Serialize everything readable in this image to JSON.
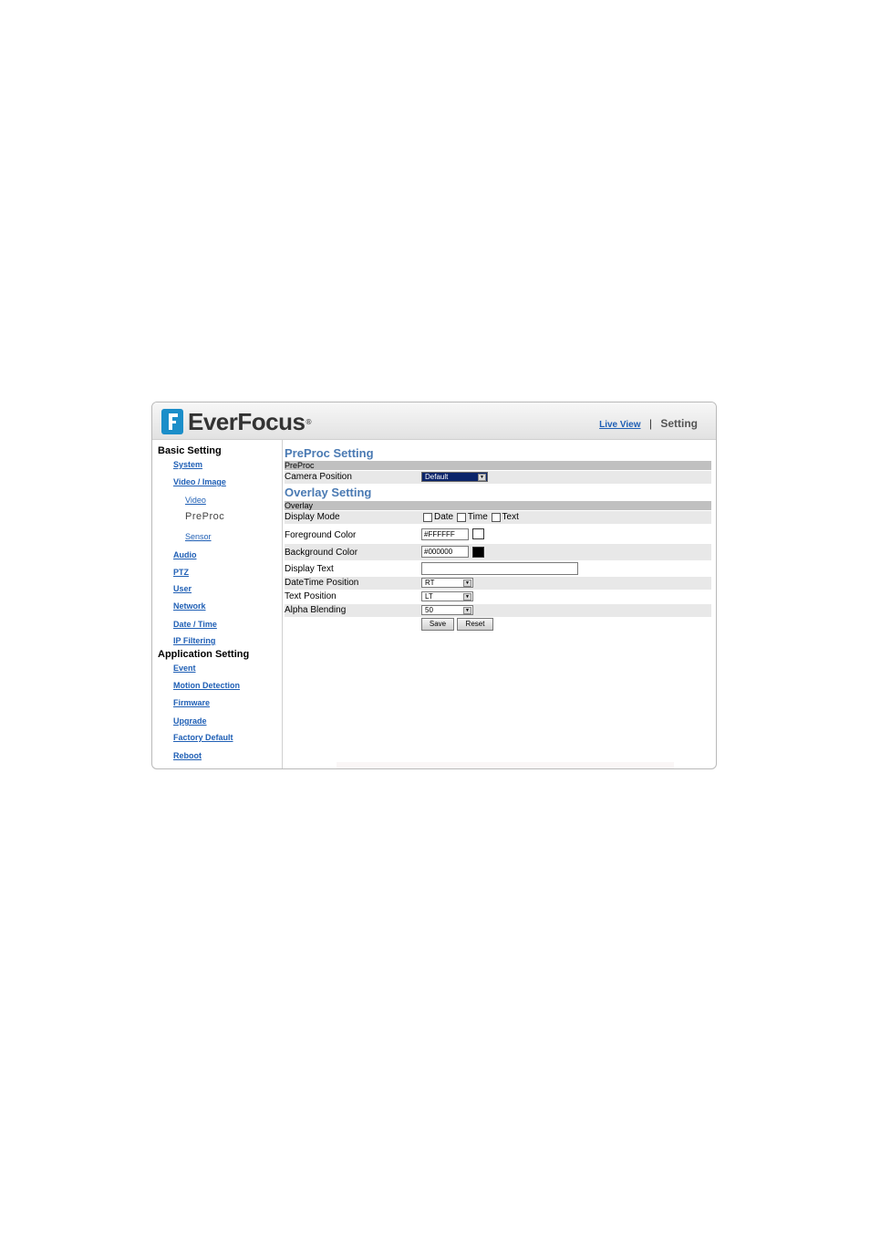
{
  "brand": {
    "name": "EverFocus",
    "reg_mark": "®"
  },
  "topnav": {
    "live_view": "Live View",
    "separator": "|",
    "setting": "Setting"
  },
  "sidebar": {
    "basic_setting": "Basic Setting",
    "system": "System",
    "video_image": "Video / Image",
    "video": "Video",
    "preproc": "PreProc",
    "sensor": "Sensor",
    "audio": "Audio",
    "ptz": "PTZ",
    "user": "User",
    "network": "Network",
    "date_time": "Date / Time",
    "ip_filtering": "IP Filtering",
    "application_setting": "Application Setting",
    "event": "Event",
    "motion_detection": "Motion Detection",
    "firmware": "Firmware",
    "upgrade": "Upgrade",
    "factory_default": "Factory Default",
    "reboot": "Reboot"
  },
  "preproc": {
    "title": "PreProc Setting",
    "section": "PreProc",
    "camera_position_label": "Camera Position",
    "camera_position_value": "Default"
  },
  "overlay": {
    "title": "Overlay Setting",
    "section": "Overlay",
    "display_mode_label": "Display Mode",
    "cb_date": "Date",
    "cb_time": "Time",
    "cb_text": "Text",
    "foreground_label": "Foreground Color",
    "foreground_value": "#FFFFFF",
    "foreground_color": "#ffffff",
    "background_label": "Background Color",
    "background_value": "#000000",
    "background_color": "#000000",
    "display_text_label": "Display Text",
    "display_text_value": "",
    "datetime_position_label": "DateTime Position",
    "datetime_position_value": "RT",
    "text_position_label": "Text Position",
    "text_position_value": "LT",
    "alpha_blending_label": "Alpha Blending",
    "alpha_blending_value": "50"
  },
  "buttons": {
    "save": "Save",
    "reset": "Reset"
  }
}
